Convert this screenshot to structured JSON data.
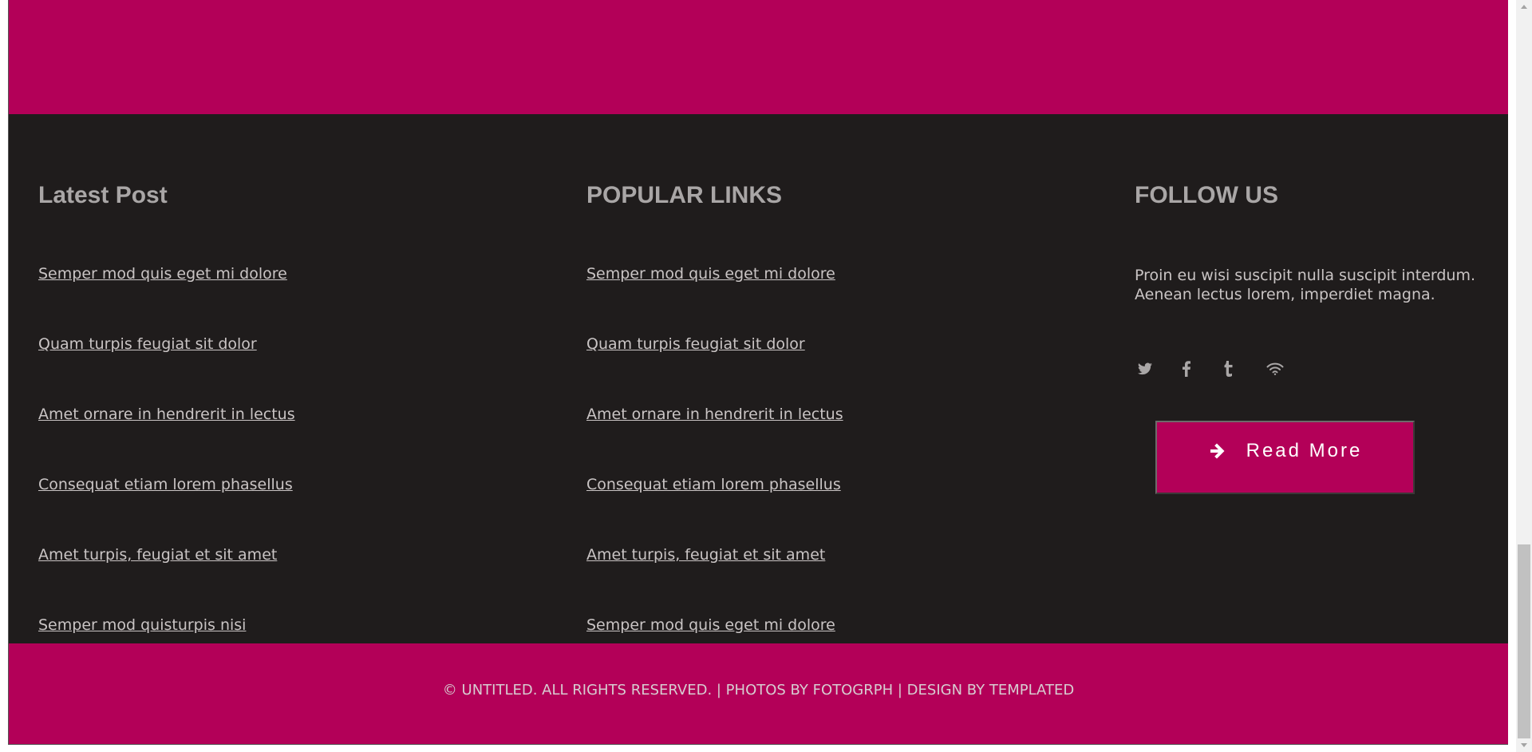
{
  "colors": {
    "accent": "#b30058",
    "footer_bg": "#1f1c1c",
    "heading": "#a9a6a6",
    "text": "#c9c4c4"
  },
  "latest_post": {
    "title": "Latest Post",
    "links": [
      "Semper mod quis eget mi dolore",
      "Quam turpis feugiat sit dolor",
      "Amet ornare in hendrerit in lectus",
      "Consequat etiam lorem phasellus",
      "Amet turpis, feugiat et sit amet",
      "Semper mod quisturpis nisi"
    ]
  },
  "popular_links": {
    "title": "POPULAR LINKS",
    "links": [
      "Semper mod quis eget mi dolore",
      "Quam turpis feugiat sit dolor",
      "Amet ornare in hendrerit in lectus",
      "Consequat etiam lorem phasellus",
      "Amet turpis, feugiat et sit amet",
      "Semper mod quis eget mi dolore"
    ]
  },
  "follow_us": {
    "title": "FOLLOW US",
    "text": "Proin eu wisi suscipit nulla suscipit interdum. Aenean lectus lorem, imperdiet magna.",
    "social_icons": [
      "twitter-icon",
      "facebook-icon",
      "tumblr-icon",
      "rss-icon"
    ],
    "button_label": "Read More",
    "button_icon": "arrow-right-icon"
  },
  "copyright": "© UNTITLED. ALL RIGHTS RESERVED. | PHOTOS BY FOTOGRPH | DESIGN BY TEMPLATED"
}
